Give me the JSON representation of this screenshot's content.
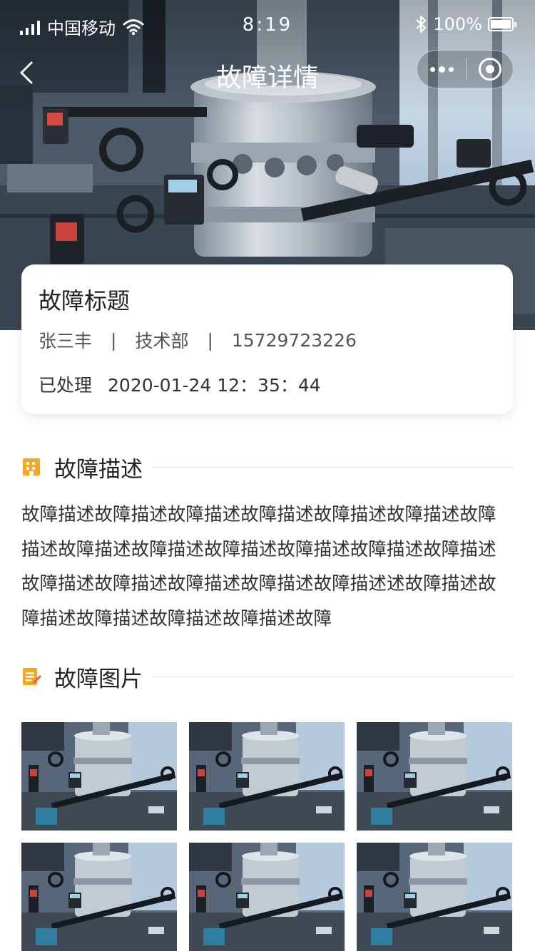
{
  "status_bar": {
    "carrier": "中国移动",
    "time": "8:19",
    "battery": "100%"
  },
  "nav": {
    "title": "故障详情"
  },
  "card": {
    "title": "故障标题",
    "person": "张三丰",
    "department": "技术部",
    "phone": "15729723226",
    "status": "已处理",
    "datetime": "2020-01-24 12：35：44"
  },
  "sections": {
    "description": {
      "heading": "故障描述",
      "text": "故障描述故障描述故障描述故障描述故障描述故障描述故障描述故障描述故障描述故障描述故障描述故障描述故障描述故障描述故障描述故障描述故障描述故障描述述故障描述故障描述故障描述故障描述故障描述故障"
    },
    "images": {
      "heading": "故障图片",
      "count": 6
    }
  },
  "colors": {
    "accent_orange": "#f5a623",
    "text_dark": "#222222",
    "divider": "#e5e5e5"
  }
}
